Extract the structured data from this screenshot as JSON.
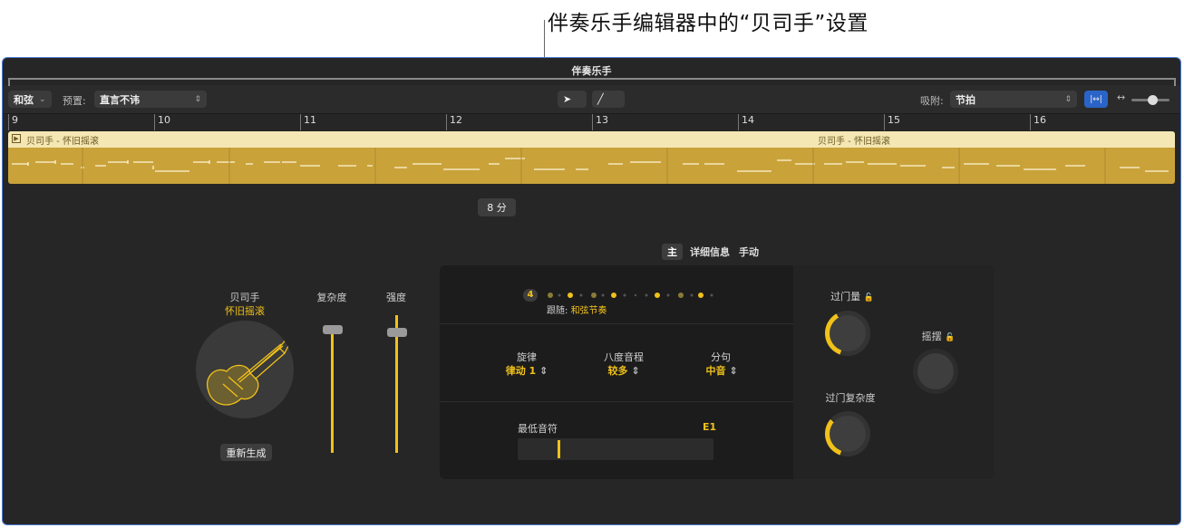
{
  "callout": "伴奏乐手编辑器中的“贝司手”设置",
  "window_title": "伴奏乐手",
  "toolbar": {
    "chords_label": "和弦",
    "preset_label": "预置:",
    "preset_value": "直言不讳",
    "snap_label": "吸附:",
    "snap_value": "节拍"
  },
  "ruler": {
    "bars": [
      "9",
      "10",
      "11",
      "12",
      "13",
      "14",
      "15",
      "16"
    ]
  },
  "region": {
    "name_1": "贝司手 - 怀旧摇滚",
    "name_2": "贝司手 - 怀旧摇滚"
  },
  "tabs": {
    "main": "主",
    "details": "详细信息",
    "manual": "手动"
  },
  "player": {
    "title": "贝司手",
    "style": "怀旧摇滚",
    "regenerate": "重新生成",
    "complexity_label": "复杂度",
    "intensity_label": "强度",
    "complexity_level": 0.9,
    "intensity_level": 0.94
  },
  "pattern": {
    "count": "4",
    "follow_label": "跟随:",
    "follow_value": "和弦节奏"
  },
  "params": {
    "rhythm_label": "旋律",
    "rhythm_value": "律动 1",
    "octave_label": "八度音程",
    "octave_value": "较多",
    "phrase_label": "分句",
    "phrase_value": "中音"
  },
  "lowest_note": {
    "label": "最低音符",
    "value": "E1"
  },
  "knobs": {
    "fills_amount_label": "过门量",
    "fills_complexity_label": "过门复杂度",
    "swing_label": "摇摆",
    "swing_value": "8 分"
  },
  "colors": {
    "accent": "#f0c11a",
    "region": "#c9a23a",
    "window_border": "#4a7bd1",
    "toggle_blue": "#2a64c8"
  }
}
